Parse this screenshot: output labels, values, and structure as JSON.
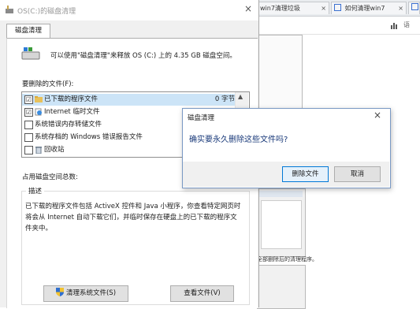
{
  "browser": {
    "tabs": [
      {
        "label": "win7清理垃圾",
        "close": "×"
      },
      {
        "label": "如何清理win7",
        "close": "×"
      },
      {
        "label": ""
      }
    ],
    "toolbar_icon": "bar-chart-icon",
    "toolbar_text": "语",
    "thumbnail_text": "全部删除后的清理程序。"
  },
  "main_window": {
    "title": "OS(C:)的磁盘清理",
    "close": "×",
    "tab_label": "磁盘清理",
    "drive_text": "可以使用\"磁盘清理\"来释放 OS (C:) 上的 4.35 GB 磁盘空间。",
    "files_label": "要删除的文件(F):",
    "files": [
      {
        "checked": "☑",
        "name": "已下载的程序文件",
        "size": "0 字节",
        "icon": "folder-icon"
      },
      {
        "checked": "☑",
        "name": "Internet 临时文件",
        "size": "",
        "icon": "internet-files-icon"
      },
      {
        "checked": "",
        "name": "系统错误内存转储文件",
        "size": "",
        "icon": ""
      },
      {
        "checked": "",
        "name": "系统存档的 Windows 错误报告文件",
        "size": "",
        "icon": ""
      },
      {
        "checked": "",
        "name": "回收站",
        "size": "",
        "icon": "recycle-bin-icon"
      }
    ],
    "space_label": "占用磁盘空间总数:",
    "desc_legend": "描述",
    "description": "已下载的程序文件包括 ActiveX 控件和 Java 小程序，你查看特定网页时将会从 Internet 自动下载它们，并临时保存在硬盘上的已下载的程序文件夹中。",
    "cleanup_system_button": "清理系统文件(S)",
    "view_files_button": "查看文件(V)"
  },
  "confirm_dialog": {
    "title": "磁盘清理",
    "close": "×",
    "message": "确实要永久删除这些文件吗?",
    "delete_button": "删除文件",
    "cancel_button": "取消"
  },
  "colors": {
    "accent": "#0078d7",
    "message_text": "#1a3a7a"
  }
}
